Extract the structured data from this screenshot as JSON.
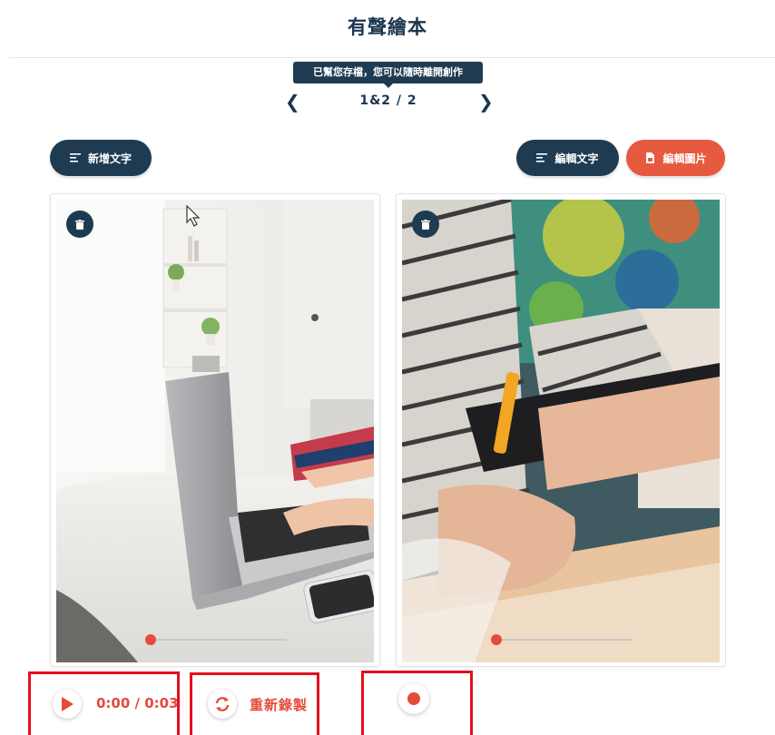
{
  "header": {
    "title": "有聲繪本"
  },
  "toast": {
    "text": "已幫您存檔，您可以隨時離開創作"
  },
  "pager": {
    "text": "1&2 / 2",
    "prev_icon": "chevron-left-icon",
    "next_icon": "chevron-right-icon"
  },
  "toolbar": {
    "add_text_label": "新增文字",
    "edit_text_label": "編輯文字",
    "edit_image_label": "編輯圖片"
  },
  "pages": [
    {
      "image": "laptop-on-table-photo",
      "audio_progress": 0.0
    },
    {
      "image": "writing-with-pen-photo",
      "audio_progress": 0.0
    }
  ],
  "audio": {
    "time_display": "0:00 / 0:03",
    "rerecord_label": "重新錄製"
  },
  "colors": {
    "navy": "#1e3b52",
    "accent": "#e65a3f",
    "highlight": "#e3101c"
  }
}
